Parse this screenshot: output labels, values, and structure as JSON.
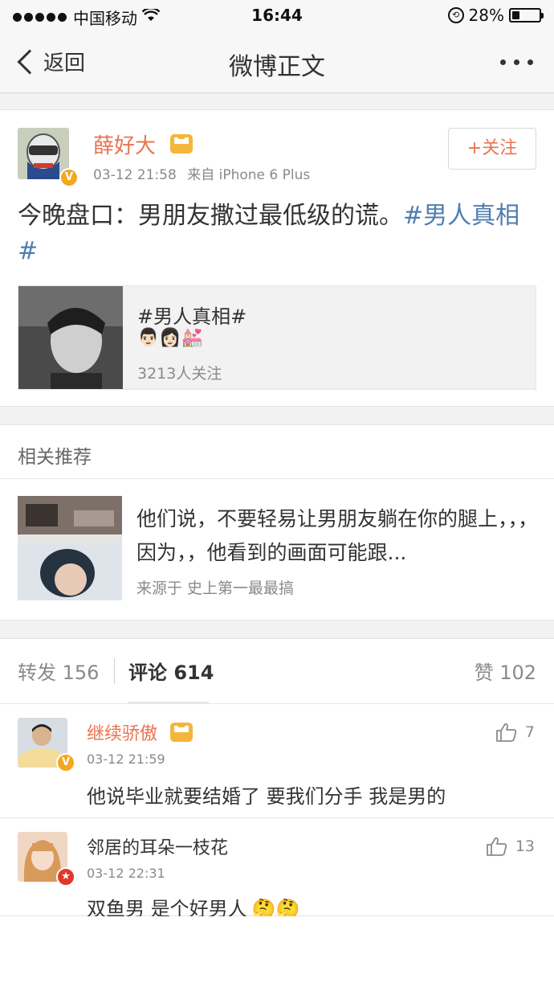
{
  "status_bar": {
    "carrier": "中国移动",
    "time": "16:44",
    "battery": "28%",
    "battery_level": 0.28
  },
  "nav": {
    "back_label": "返回",
    "title": "微博正文"
  },
  "post": {
    "author": "薛好大",
    "time": "03-12 21:58",
    "source": "来自 iPhone 6 Plus",
    "follow_label": "+关注",
    "text_main": "今晚盘口：男朋友撒过最低级的谎。",
    "text_hashtag": "#男人真相#",
    "topic": {
      "title": "#男人真相#",
      "emoji": "👨🏻👩🏻💒",
      "followers": "3213人关注"
    }
  },
  "recommend": {
    "header": "相关推荐",
    "text": "他们说，不要轻易让男朋友躺在你的腿上，，，因为，，他看到的画面可能跟...",
    "source": "来源于 史上第一最最搞"
  },
  "tabs": {
    "repost": "转发 156",
    "comment": "评论 614",
    "like": "赞 102"
  },
  "comments": [
    {
      "name": "继续骄傲",
      "time": "03-12 21:59",
      "text": "他说毕业就要结婚了 要我们分手 我是男的",
      "likes": "7",
      "name_color": "#eb7350"
    },
    {
      "name": "邻居的耳朵一枝花",
      "time": "03-12 22:31",
      "text": "双鱼男 是个好男人",
      "emoji": "🤔🤔",
      "likes": "13",
      "name_color": "#333333"
    }
  ]
}
